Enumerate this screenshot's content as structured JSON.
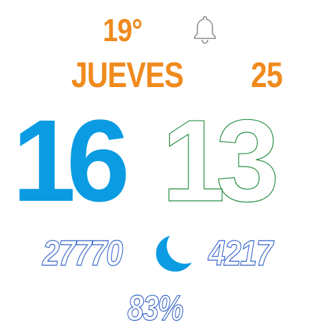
{
  "colors": {
    "accent_orange": "#f08a1e",
    "hours_blue": "#0a9be2",
    "minutes_outline_green": "#1e8a3a",
    "stats_outline_blue": "#2a5cc8",
    "background": "#ffffff"
  },
  "watchface": {
    "temperature": "19°",
    "alarm_icon": "bell-icon",
    "day_of_week": "JUEVES",
    "day_of_month": "25",
    "time": {
      "hours": "16",
      "minutes": "13"
    },
    "steps": "27770",
    "moon_icon": "crescent-moon-icon",
    "distance": "4217",
    "battery": "83%"
  }
}
